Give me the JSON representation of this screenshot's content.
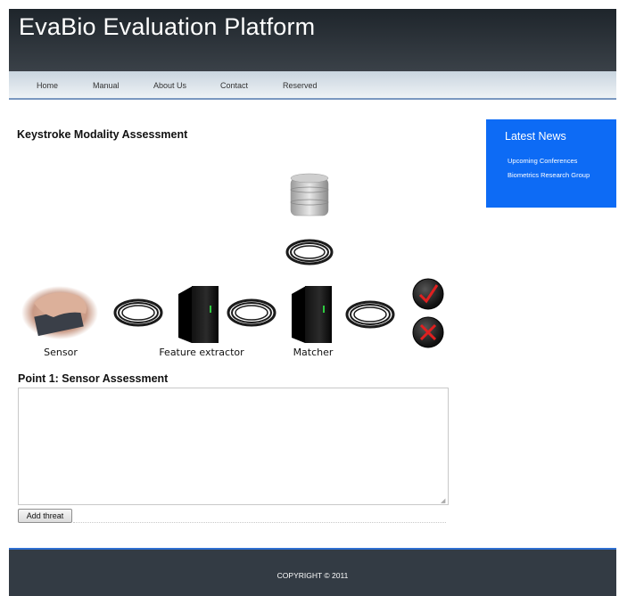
{
  "header": {
    "title": "EvaBio Evaluation Platform"
  },
  "nav": {
    "items": [
      "Home",
      "Manual",
      "About Us",
      "Contact",
      "Reserved"
    ]
  },
  "main": {
    "heading": "Keystroke Modality Assessment",
    "diagram": {
      "labels": {
        "sensor": "Sensor",
        "feature_extractor": "Feature extractor",
        "matcher": "Matcher"
      }
    },
    "point_title": "Point 1: Sensor Assessment",
    "threat_input": {
      "value": "",
      "placeholder": ""
    },
    "add_threat_label": "Add threat"
  },
  "sidebar": {
    "title": "Latest News",
    "links": [
      "Upcoming Conferences",
      "Biometrics Research Group"
    ],
    "background": "#0d6bf5"
  },
  "footer": {
    "copyright": "COPYRIGHT © 2011"
  },
  "colors": {
    "header_dark": "#1e252b",
    "footer": "#333b44",
    "accent_blue": "#2f6fd0"
  }
}
